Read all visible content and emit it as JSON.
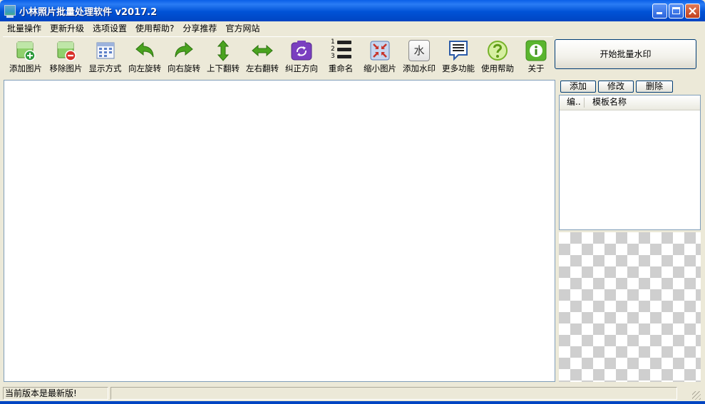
{
  "window": {
    "title": "小林照片批量处理软件 v2017.2"
  },
  "menu": [
    {
      "label": "批量操作"
    },
    {
      "label": "更新升级"
    },
    {
      "label": "选项设置"
    },
    {
      "label": "使用帮助?"
    },
    {
      "label": "分享推荐"
    },
    {
      "label": "官方网站"
    }
  ],
  "toolbar": [
    {
      "label": "添加图片",
      "icon": "add-image-icon"
    },
    {
      "label": "移除图片",
      "icon": "remove-image-icon"
    },
    {
      "label": "显示方式",
      "icon": "display-mode-icon"
    },
    {
      "label": "向左旋转",
      "icon": "rotate-left-icon"
    },
    {
      "label": "向右旋转",
      "icon": "rotate-right-icon"
    },
    {
      "label": "上下翻转",
      "icon": "flip-vertical-icon"
    },
    {
      "label": "左右翻转",
      "icon": "flip-horizontal-icon"
    },
    {
      "label": "纠正方向",
      "icon": "correct-orientation-icon"
    },
    {
      "label": "重命名",
      "icon": "rename-icon"
    },
    {
      "label": "缩小图片",
      "icon": "shrink-image-icon"
    },
    {
      "label": "添加水印",
      "icon": "watermark-icon"
    },
    {
      "label": "更多功能",
      "icon": "more-features-icon"
    },
    {
      "label": "使用帮助",
      "icon": "help-icon"
    },
    {
      "label": "关于",
      "icon": "about-icon"
    }
  ],
  "watermark_icon_text": "水",
  "rename_icon_digits": [
    "1",
    "2",
    "3"
  ],
  "start_button": "开始批量水印",
  "template_panel": {
    "add": "添加",
    "edit": "修改",
    "delete": "删除",
    "col_number": "编..",
    "col_name": "模板名称"
  },
  "status": {
    "message": "当前版本是最新版!"
  },
  "colors": {
    "titlebar": "#0a5fe8",
    "window_bg": "#ece9d8",
    "green_arrow": "#4aa31f",
    "purple_icon": "#7a3fc0"
  }
}
